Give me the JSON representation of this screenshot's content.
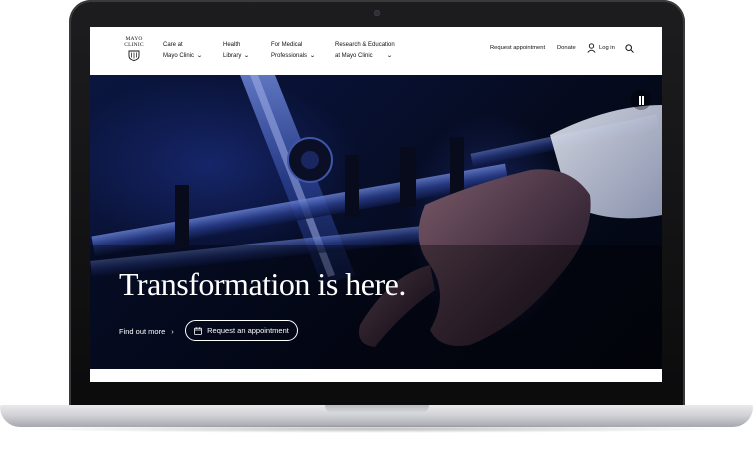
{
  "header": {
    "logo_text_line1": "MAYO",
    "logo_text_line2": "CLINIC",
    "nav": [
      {
        "line1": "Care at",
        "line2": "Mayo Clinic"
      },
      {
        "line1": "Health",
        "line2": "Library"
      },
      {
        "line1": "For Medical",
        "line2": "Professionals"
      },
      {
        "line1": "Research & Education",
        "line2": "at Mayo Clinic"
      }
    ],
    "request_appointment": "Request appointment",
    "donate": "Donate",
    "login": "Log in"
  },
  "hero": {
    "headline": "Transformation is here.",
    "find_out_more": "Find out more",
    "appointment_button": "Request an appointment"
  },
  "icons": {
    "chevron": "chevron-down-icon",
    "user": "user-icon",
    "search": "search-icon",
    "pause": "pause-icon",
    "calendar": "calendar-icon",
    "arrow": "chevron-right-icon"
  },
  "colors": {
    "header_bg": "#ffffff",
    "hero_dark": "#050a1d",
    "hero_blue": "#1e3c9c",
    "text_on_hero": "#ffffff"
  }
}
